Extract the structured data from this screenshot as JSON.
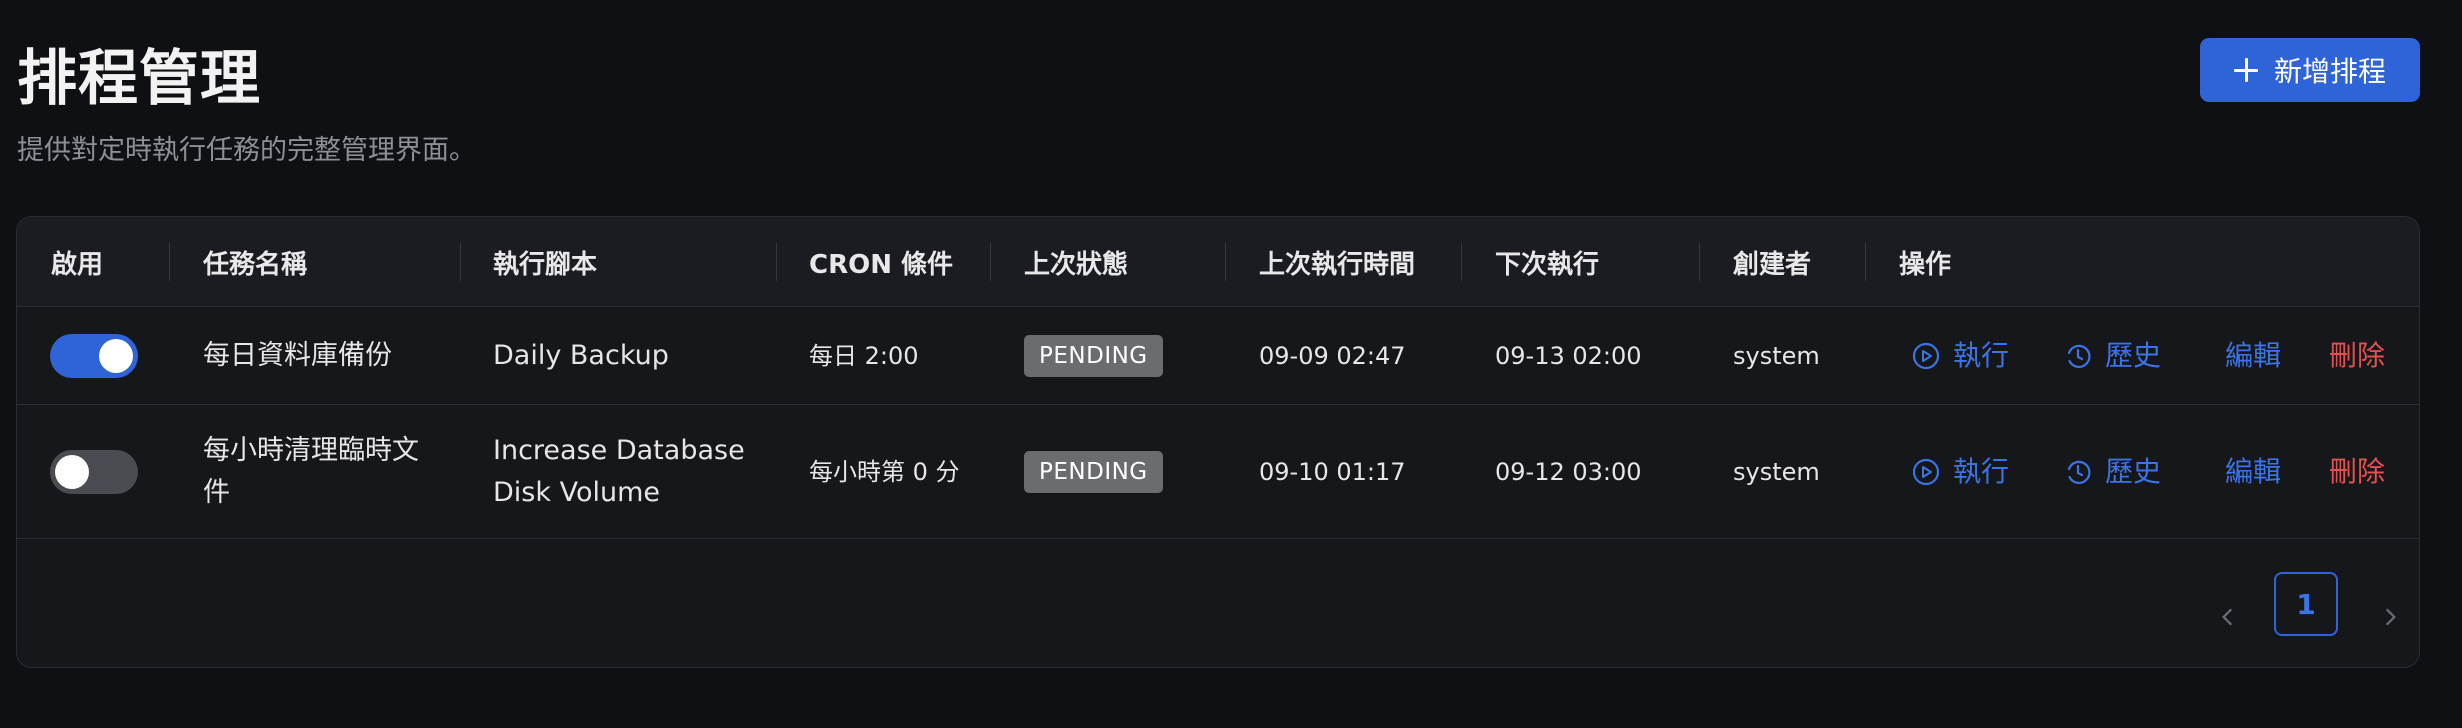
{
  "header": {
    "title": "排程管理",
    "subtitle": "提供對定時執行任務的完整管理界面。",
    "add_label": "新增排程"
  },
  "table": {
    "columns": [
      "啟用",
      "任務名稱",
      "執行腳本",
      "CRON 條件",
      "上次狀態",
      "上次執行時間",
      "下次執行",
      "創建者",
      "操作"
    ],
    "rows": [
      {
        "enabled": true,
        "name": "每日資料庫備份",
        "script": "Daily Backup",
        "cron": "每日 2:00",
        "status": "PENDING",
        "last_run": "09-09 02:47",
        "next_run": "09-13 02:00",
        "creator": "system"
      },
      {
        "enabled": false,
        "name": "每小時清理臨時文件",
        "script": "Increase Database Disk Volume",
        "cron": "每小時第 0 分",
        "status": "PENDING",
        "last_run": "09-10 01:17",
        "next_run": "09-12 03:00",
        "creator": "system"
      }
    ],
    "actions": {
      "run": "執行",
      "history": "歷史",
      "edit": "編輯",
      "delete": "刪除"
    }
  },
  "pagination": {
    "current_page": "1",
    "prev_icon": "chevron-left-icon",
    "next_icon": "chevron-right-icon"
  },
  "colors": {
    "accent": "#2f64d8",
    "link": "#3b74e6",
    "danger": "#e05252",
    "badge": "#6b6c70"
  }
}
